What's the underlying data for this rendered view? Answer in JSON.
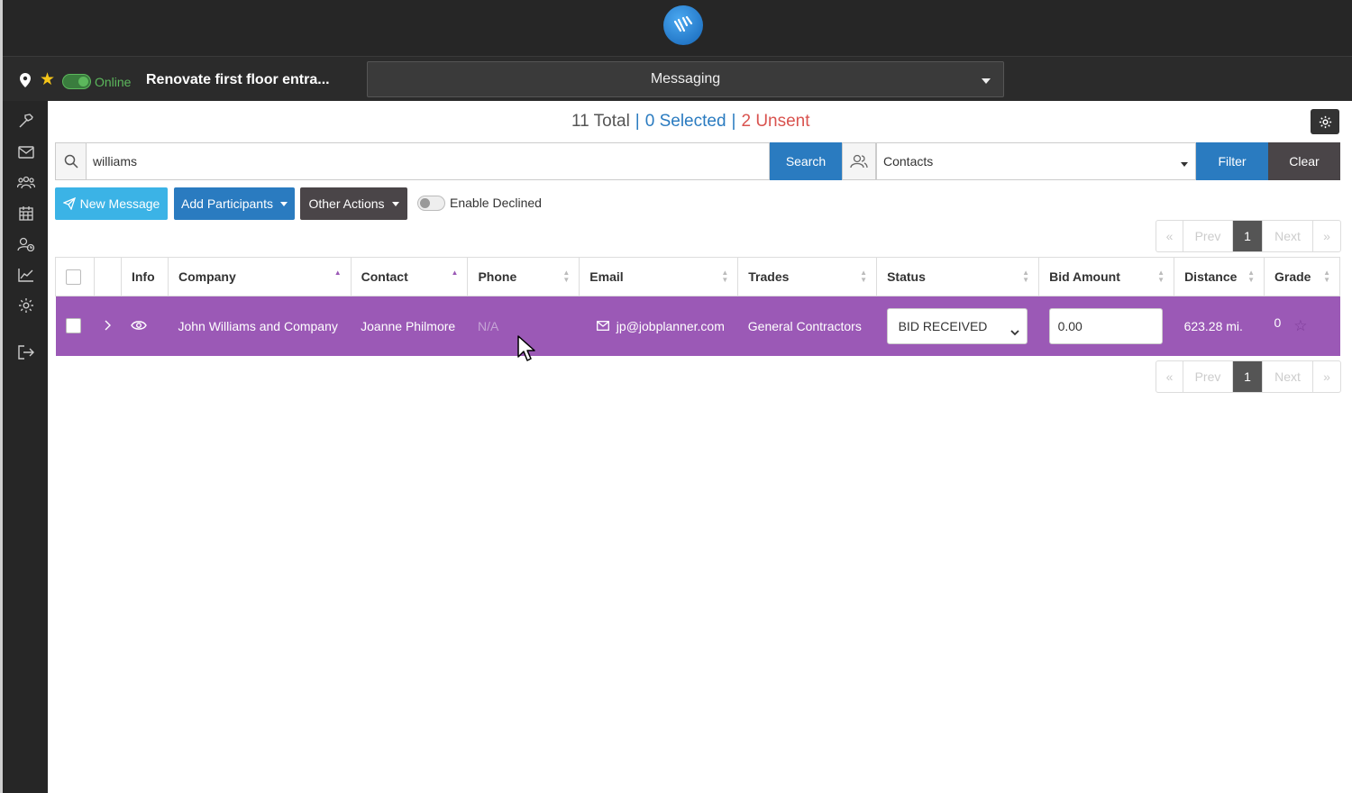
{
  "project": {
    "status": "Online",
    "name": "Renovate first floor entra..."
  },
  "module_select": {
    "value": "Messaging"
  },
  "stats": {
    "total": "11 Total",
    "selected": "0 Selected",
    "unsent": "2 Unsent",
    "separator": "|"
  },
  "search": {
    "value": "williams",
    "button": "Search"
  },
  "filter": {
    "select_value": "Contacts",
    "filter_button": "Filter",
    "clear_button": "Clear"
  },
  "actions": {
    "new_message": "New Message",
    "add_participants": "Add Participants",
    "other_actions": "Other Actions",
    "enable_declined": "Enable Declined"
  },
  "pagination": {
    "first": "«",
    "prev": "Prev",
    "current": "1",
    "next": "Next",
    "last": "»"
  },
  "table": {
    "columns": [
      "Info",
      "Company",
      "Contact",
      "Phone",
      "Email",
      "Trades",
      "Status",
      "Bid Amount",
      "Distance",
      "Grade"
    ],
    "rows": [
      {
        "company": "John Williams and Company",
        "contact": "Joanne Philmore",
        "phone": "N/A",
        "email": "jp@jobplanner.com",
        "trades": "General Contractors",
        "status": "BID RECEIVED",
        "bid_amount": "0.00",
        "distance": "623.28 mi.",
        "grade": "0"
      }
    ]
  },
  "colors": {
    "row_highlight": "#9b59b6",
    "primary": "#2a7bc0",
    "danger": "#d9534f",
    "online": "#5cb85c"
  }
}
